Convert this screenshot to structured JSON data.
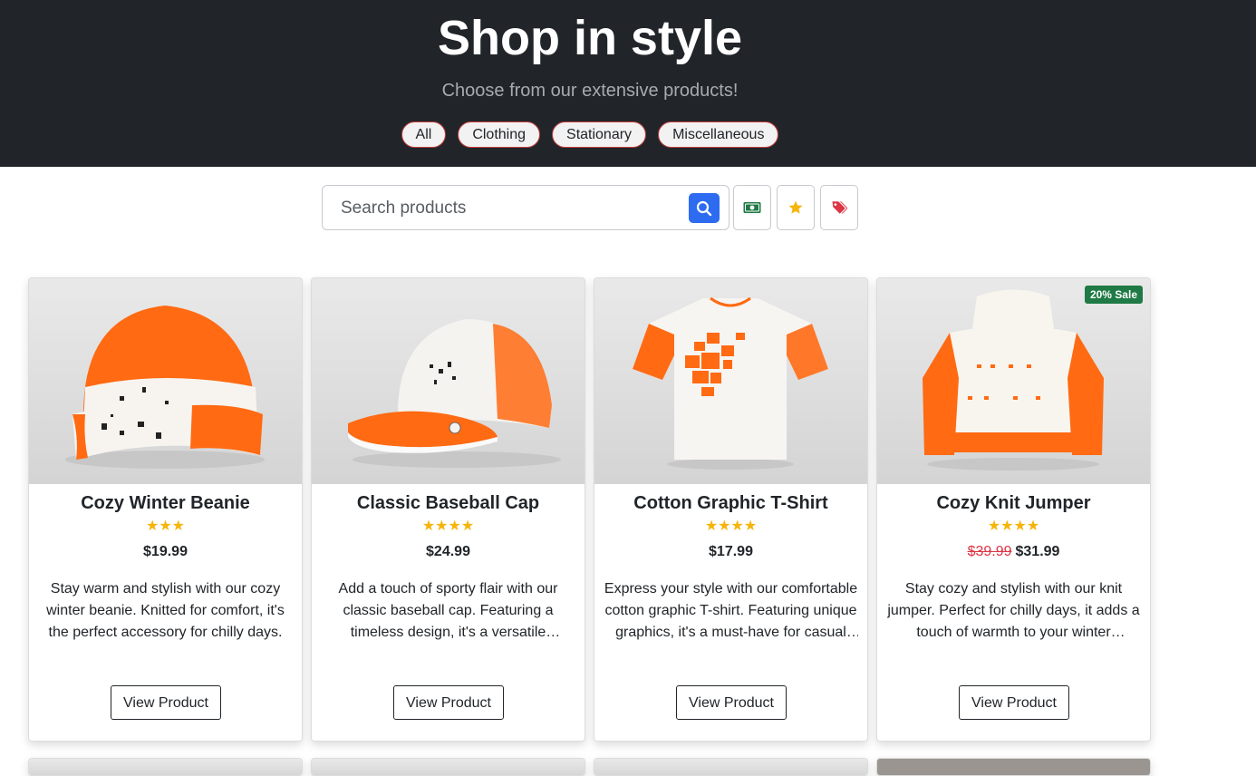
{
  "hero": {
    "title": "Shop in style",
    "subtitle": "Choose from our extensive products!",
    "filters": [
      "All",
      "Clothing",
      "Stationary",
      "Miscellaneous"
    ]
  },
  "search": {
    "placeholder": "Search products",
    "search_icon": "search-icon",
    "tools": [
      {
        "icon": "money-bill-icon",
        "color": "#1f7a45"
      },
      {
        "icon": "star-icon",
        "color": "#f5b50a"
      },
      {
        "icon": "tags-icon",
        "color": "#dc3545"
      }
    ]
  },
  "colors": {
    "accent_blue": "#2d6bf0",
    "hero_bg": "#212529",
    "star": "#f5b50a",
    "sale_badge": "#1f7a45",
    "old_price": "#dc3545"
  },
  "products": [
    {
      "name": "Cozy Winter Beanie",
      "rating": 3,
      "price": "$19.99",
      "old_price": null,
      "badge": null,
      "description": "Stay warm and stylish with our cozy winter beanie. Knitted for comfort, it's the perfect accessory for chilly days.",
      "button": "View Product",
      "image": "beanie"
    },
    {
      "name": "Classic Baseball Cap",
      "rating": 4,
      "price": "$24.99",
      "old_price": null,
      "badge": null,
      "description": "Add a touch of sporty flair with our classic baseball cap. Featuring a timeless design, it's a versatile accessory for any outfit.",
      "button": "View Product",
      "image": "cap"
    },
    {
      "name": "Cotton Graphic T-Shirt",
      "rating": 4,
      "price": "$17.99",
      "old_price": null,
      "badge": null,
      "description": "Express your style with our comfortable cotton graphic T-shirt. Featuring unique graphics, it's a must-have for casual days.",
      "button": "View Product",
      "image": "tshirt"
    },
    {
      "name": "Cozy Knit Jumper",
      "rating": 4,
      "price": "$31.99",
      "old_price": "$39.99",
      "badge": "20% Sale",
      "description": "Stay cozy and stylish with our knit jumper. Perfect for chilly days, it adds a touch of warmth to your winter wardrobe.",
      "button": "View Product",
      "image": "jumper"
    }
  ]
}
